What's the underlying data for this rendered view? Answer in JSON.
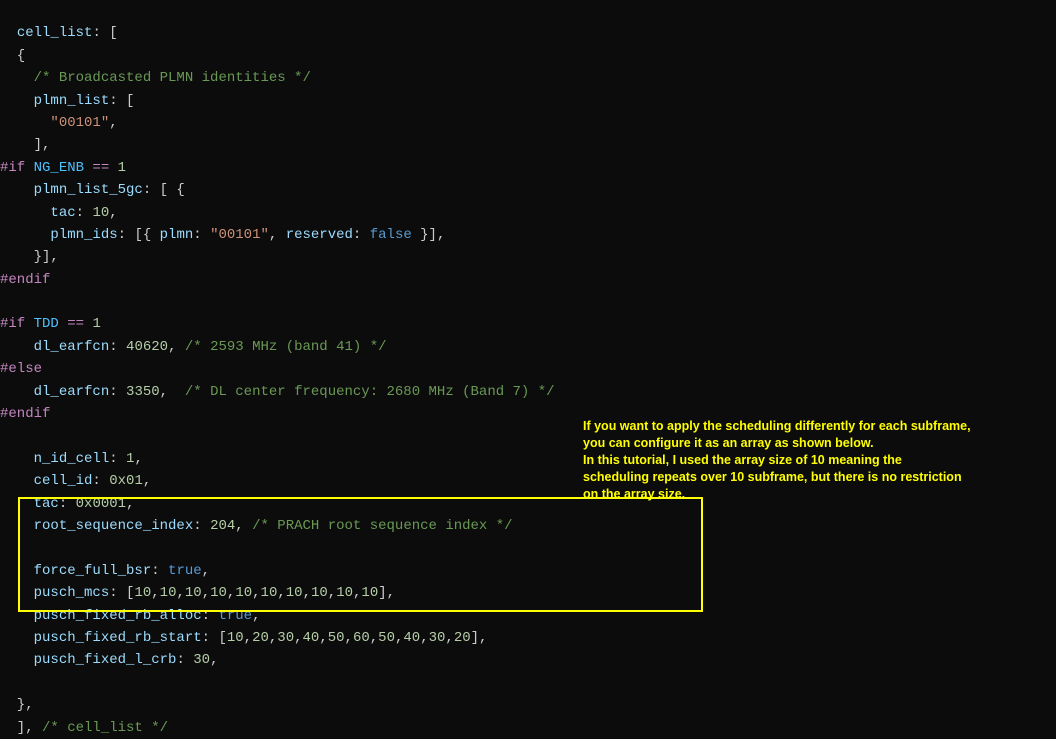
{
  "code": {
    "l1": "  cell_list: [",
    "l2": "  {",
    "l3a": "    /* Broadcasted PLMN identities */",
    "l4a": "    plmn_list: [",
    "l5a": "      \"00101\",",
    "l6": "    ],",
    "l7a": "#if NG_ENB == 1",
    "l8a": "    plmn_list_5gc: [ {",
    "l9a": "      tac: 10,",
    "l10a": "      plmn_ids: [{ plmn: \"00101\", reserved: false }],",
    "l11": "    }],",
    "l12": "#endif",
    "l13": "",
    "l14a": "#if TDD == 1",
    "l15a": "    dl_earfcn: 40620, /* 2593 MHz (band 41) */",
    "l16": "#else",
    "l17a": "    dl_earfcn: 3350,  /* DL center frequency: 2680 MHz (Band 7) */",
    "l18": "#endif",
    "l19": "",
    "l20a": "    n_id_cell: 1,",
    "l21a": "    cell_id: 0x01,",
    "l22a": "    tac: 0x0001,",
    "l23a": "    root_sequence_index: 204, /* PRACH root sequence index */",
    "l24": "",
    "l25a": "    force_full_bsr: true,",
    "l26a": "    pusch_mcs: [10,10,10,10,10,10,10,10,10,10],",
    "l27a": "    pusch_fixed_rb_alloc: true,",
    "l28a": "    pusch_fixed_rb_start: [10,20,30,40,50,60,50,40,30,20],",
    "l29a": "    pusch_fixed_l_crb: 30,",
    "l30": "",
    "l31": "  },",
    "l32a": "  ], /* cell_list */"
  },
  "annotation": {
    "line1": "If you want to apply the scheduling differently for each subframe,",
    "line2": "you can configure it as an array as shown below.",
    "line3": "In this tutorial, I used the array size of 10 meaning the",
    "line4": "scheduling repeats over 10 subframe, but there is no restriction",
    "line5": "on the array size."
  }
}
